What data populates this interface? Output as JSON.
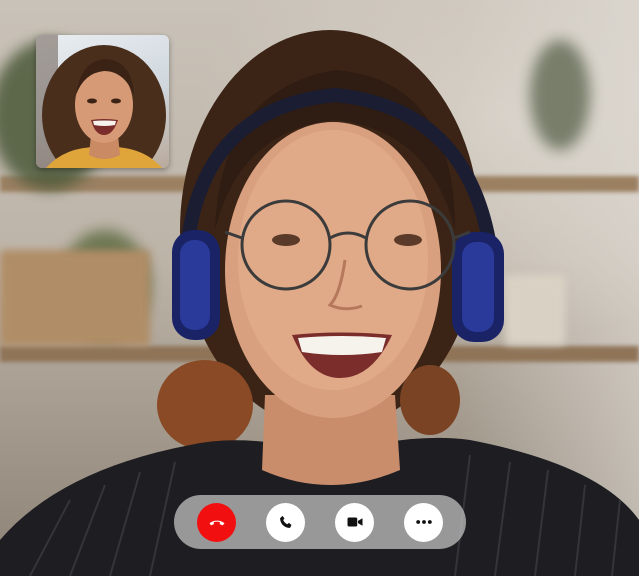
{
  "call": {
    "main_participant": {
      "image_icon": "woman-with-headphones-smiling"
    },
    "self_view": {
      "image_icon": "self-preview-woman-smiling"
    }
  },
  "controls": [
    {
      "name": "end-call-button",
      "icon": "hang-up-phone-icon",
      "color": "#f20f0f"
    },
    {
      "name": "audio-call-button",
      "icon": "phone-icon",
      "color": "#ffffff"
    },
    {
      "name": "video-toggle-button",
      "icon": "video-camera-icon",
      "color": "#ffffff"
    },
    {
      "name": "more-options-button",
      "icon": "more-horizontal-icon",
      "color": "#ffffff"
    }
  ],
  "theme": {
    "end_call_red": "#f20f0f",
    "control_bar_bg": "rgba(200,200,200,0.72)"
  }
}
